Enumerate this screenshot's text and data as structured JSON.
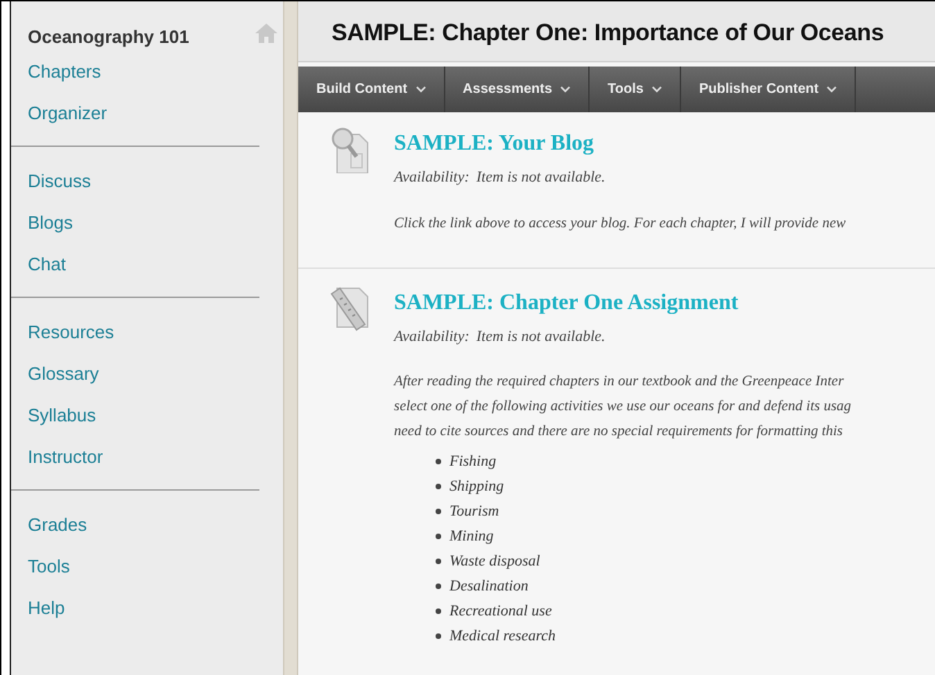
{
  "sidebar": {
    "title": "Oceanography 101",
    "groups": [
      {
        "items": [
          "Chapters",
          "Organizer"
        ]
      },
      {
        "items": [
          "Discuss",
          "Blogs",
          "Chat"
        ]
      },
      {
        "items": [
          "Resources",
          "Glossary",
          "Syllabus",
          "Instructor"
        ]
      },
      {
        "items": [
          "Grades",
          "Tools",
          "Help"
        ]
      }
    ]
  },
  "page_title": "SAMPLE: Chapter One: Importance of Our Oceans",
  "menu": [
    "Build Content",
    "Assessments",
    "Tools",
    "Publisher Content"
  ],
  "content_items": [
    {
      "kind": "blog",
      "title": "SAMPLE: Your Blog",
      "availability_label": "Availability:",
      "availability": "Item is not available.",
      "paragraph": [
        "Click the link above to access your blog. For each chapter, I will provide new"
      ]
    },
    {
      "kind": "assignment",
      "title": "SAMPLE: Chapter One Assignment",
      "availability_label": "Availability:",
      "availability": "Item is not available.",
      "paragraph": [
        "After reading the required chapters in our textbook and the Greenpeace Inter",
        "select one of the following activities we use our oceans for and defend its usag",
        "need to cite sources and there are no special requirements for formatting this"
      ],
      "bullets": [
        "Fishing",
        "Shipping",
        "Tourism",
        "Mining",
        "Waste disposal",
        "Desalination",
        "Recreational use",
        "Medical research"
      ]
    }
  ]
}
